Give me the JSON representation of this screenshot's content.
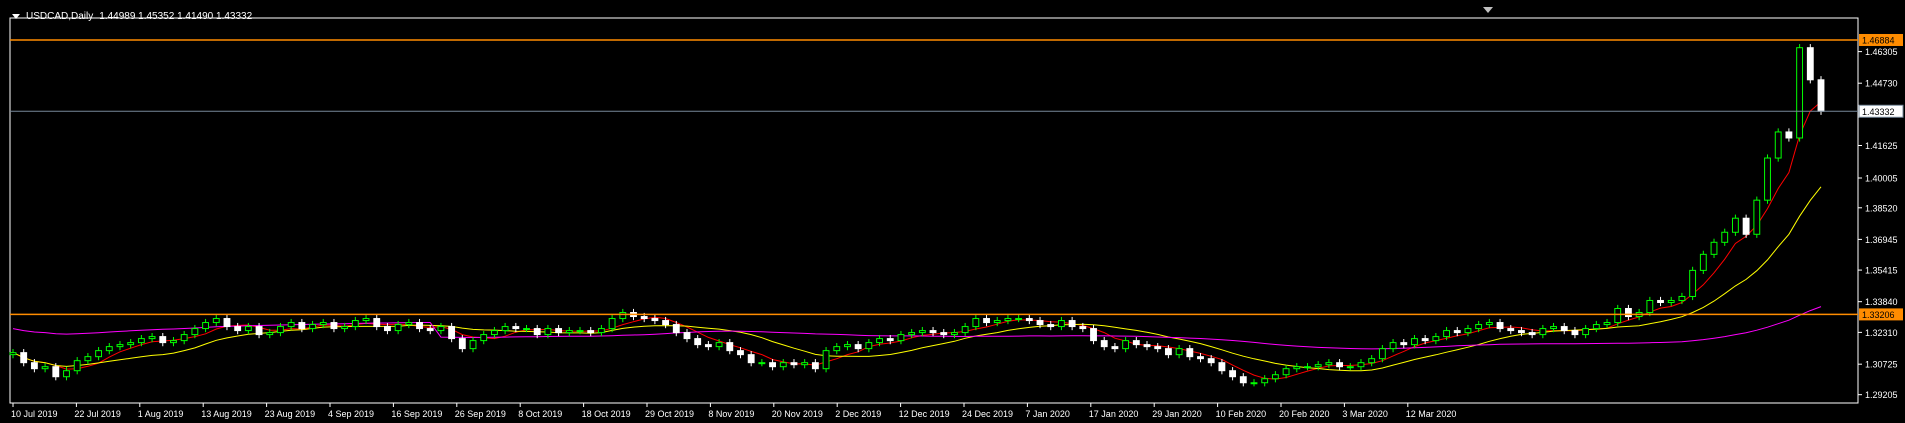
{
  "window": {
    "symbol_period": "USDCAD,Daily",
    "ohlc_values": "1.44989 1.45352 1.41490 1.43332"
  },
  "colors": {
    "background": "#000000",
    "axis": "#ffffff",
    "bull_candle": "#00ff00",
    "bear_candle": "#ffffff",
    "ma_fast": "#ff0000",
    "ma_mid": "#ffff00",
    "ma_slow": "#ff00ff",
    "hline": "#ff8c00",
    "bid_line": "#778899"
  },
  "chart_data": {
    "type": "candlestick",
    "symbol": "USDCAD",
    "timeframe": "Daily",
    "ylim": [
      1.2879,
      1.4798
    ],
    "y_ticks": [
      "1.46305",
      "1.44730",
      "1.41625",
      "1.40005",
      "1.38520",
      "1.36945",
      "1.35415",
      "1.33840",
      "1.32310",
      "1.30725",
      "1.29205"
    ],
    "x_ticks": [
      "10 Jul 2019",
      "22 Jul 2019",
      "1 Aug 2019",
      "13 Aug 2019",
      "23 Aug 2019",
      "4 Sep 2019",
      "16 Sep 2019",
      "26 Sep 2019",
      "8 Oct 2019",
      "18 Oct 2019",
      "29 Oct 2019",
      "8 Nov 2019",
      "20 Nov 2019",
      "2 Dec 2019",
      "12 Dec 2019",
      "24 Dec 2019",
      "7 Jan 2020",
      "17 Jan 2020",
      "29 Jan 2020",
      "10 Feb 2020",
      "20 Feb 2020",
      "3 Mar 2020",
      "12 Mar 2020"
    ],
    "horizontal_lines": [
      {
        "price": 1.46884,
        "label": "1.46884"
      },
      {
        "price": 1.33206,
        "label": "1.33206"
      }
    ],
    "bid_line": {
      "price": 1.43332,
      "label": "1.43332"
    },
    "close_path": [
      1.313,
      1.308,
      1.305,
      1.306,
      1.301,
      1.304,
      1.309,
      1.311,
      1.314,
      1.316,
      1.317,
      1.318,
      1.32,
      1.321,
      1.318,
      1.319,
      1.322,
      1.325,
      1.328,
      1.33,
      1.326,
      1.324,
      1.326,
      1.322,
      1.323,
      1.326,
      1.328,
      1.325,
      1.327,
      1.328,
      1.325,
      1.326,
      1.329,
      1.33,
      1.326,
      1.324,
      1.327,
      1.328,
      1.325,
      1.324,
      1.326,
      1.32,
      1.315,
      1.319,
      1.322,
      1.324,
      1.326,
      1.325,
      1.325,
      1.322,
      1.325,
      1.323,
      1.324,
      1.324,
      1.323,
      1.325,
      1.33,
      1.333,
      1.331,
      1.33,
      1.329,
      1.327,
      1.323,
      1.32,
      1.317,
      1.316,
      1.318,
      1.314,
      1.312,
      1.308,
      1.308,
      1.306,
      1.308,
      1.307,
      1.308,
      1.305,
      1.314,
      1.316,
      1.317,
      1.315,
      1.318,
      1.32,
      1.319,
      1.322,
      1.323,
      1.324,
      1.323,
      1.322,
      1.323,
      1.326,
      1.33,
      1.328,
      1.329,
      1.33,
      1.33,
      1.329,
      1.327,
      1.326,
      1.329,
      1.326,
      1.325,
      1.319,
      1.316,
      1.315,
      1.319,
      1.317,
      1.316,
      1.315,
      1.312,
      1.315,
      1.311,
      1.31,
      1.308,
      1.304,
      1.301,
      1.298,
      1.298,
      1.3,
      1.302,
      1.305,
      1.306,
      1.306,
      1.307,
      1.308,
      1.306,
      1.306,
      1.308,
      1.31,
      1.315,
      1.318,
      1.317,
      1.32,
      1.319,
      1.321,
      1.324,
      1.323,
      1.325,
      1.327,
      1.328,
      1.325,
      1.324,
      1.323,
      1.322,
      1.325,
      1.326,
      1.324,
      1.322,
      1.325,
      1.327,
      1.328,
      1.335,
      1.331,
      1.333,
      1.339,
      1.338,
      1.339,
      1.341,
      1.354,
      1.362,
      1.368,
      1.373,
      1.38,
      1.372,
      1.389,
      1.41,
      1.423,
      1.42,
      1.465,
      1.449,
      1.4333
    ]
  }
}
